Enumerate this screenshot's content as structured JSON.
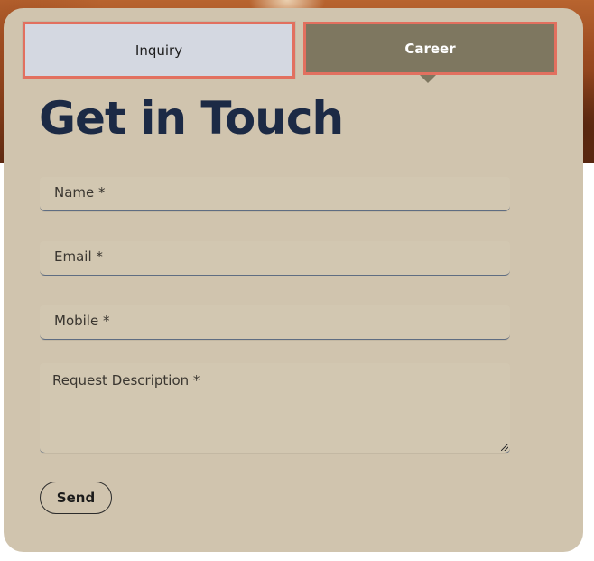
{
  "tabs": {
    "inquiry_label": "Inquiry",
    "career_label": "Career"
  },
  "heading": "Get in Touch",
  "form": {
    "name_placeholder": "Name *",
    "email_placeholder": "Email *",
    "mobile_placeholder": "Mobile *",
    "description_placeholder": "Request Description *",
    "send_label": "Send"
  },
  "colors": {
    "card_background": "#d0c4ae",
    "inquiry_tab": "#d4d8e1",
    "career_tab": "#7e7760",
    "heading": "#1c2a45",
    "highlight_border": "#e2705f"
  }
}
